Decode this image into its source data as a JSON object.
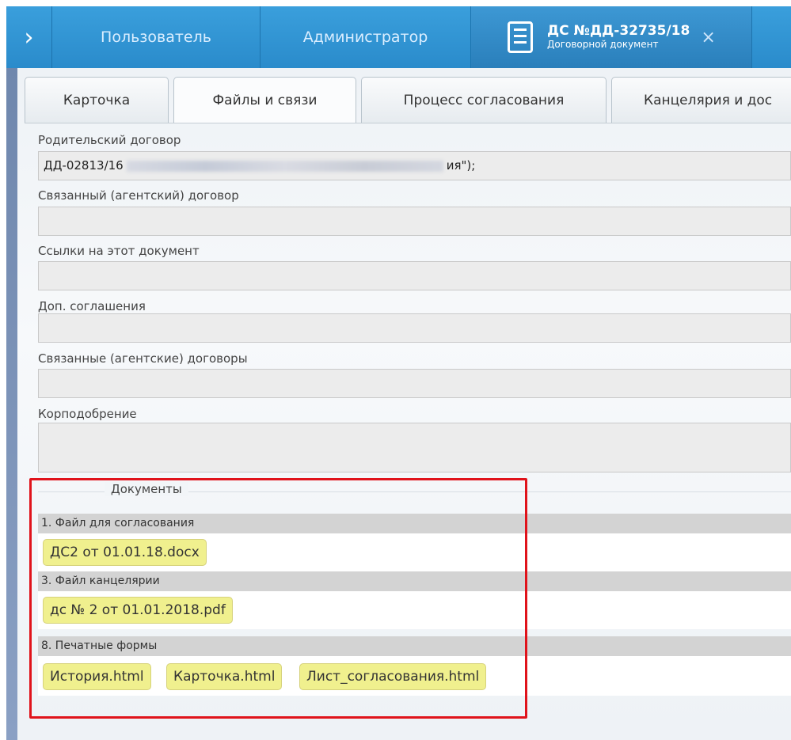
{
  "topbar": {
    "expand_glyph": "›",
    "user_label": "Пользователь",
    "admin_label": "Администратор",
    "doc_tab": {
      "title": "ДС №ДД-32735/18",
      "subtitle": "Договорной документ",
      "close_glyph": "×",
      "icon": "document-icon"
    }
  },
  "tabs": [
    {
      "label": "Карточка"
    },
    {
      "label": "Файлы и связи",
      "active": true
    },
    {
      "label": "Процесс согласования"
    },
    {
      "label": "Канцелярия и дос"
    }
  ],
  "fields": {
    "parent_contract": {
      "label": "Родительский договор",
      "value_start": "ДД-02813/16",
      "value_end": "ия\");"
    },
    "linked_agent_contract": {
      "label": "Связанный (агентский) договор",
      "value": ""
    },
    "links_to_document": {
      "label": "Ссылки на этот документ",
      "value": ""
    },
    "supplementary_agreements": {
      "label": "Доп. соглашения",
      "value": ""
    },
    "linked_agent_contracts": {
      "label": "Связанные (агентские) договоры",
      "value": ""
    },
    "corp_approval": {
      "label": "Корподобрение",
      "value": ""
    }
  },
  "documents": {
    "legend": "Документы",
    "sections": [
      {
        "header": "1. Файл для согласования",
        "files": [
          "ДС2 от 01.01.18.docx"
        ]
      },
      {
        "header": "3. Файл канцелярии",
        "files": [
          "дс № 2 от 01.01.2018.pdf"
        ]
      },
      {
        "header": "8. Печатные формы",
        "files": [
          "История.html",
          "Карточка.html",
          "Лист_согласования.html"
        ]
      }
    ]
  },
  "colors": {
    "topbar": "#2a8bcb",
    "file_chip": "#f0f08e",
    "highlight": "#e0131b"
  }
}
